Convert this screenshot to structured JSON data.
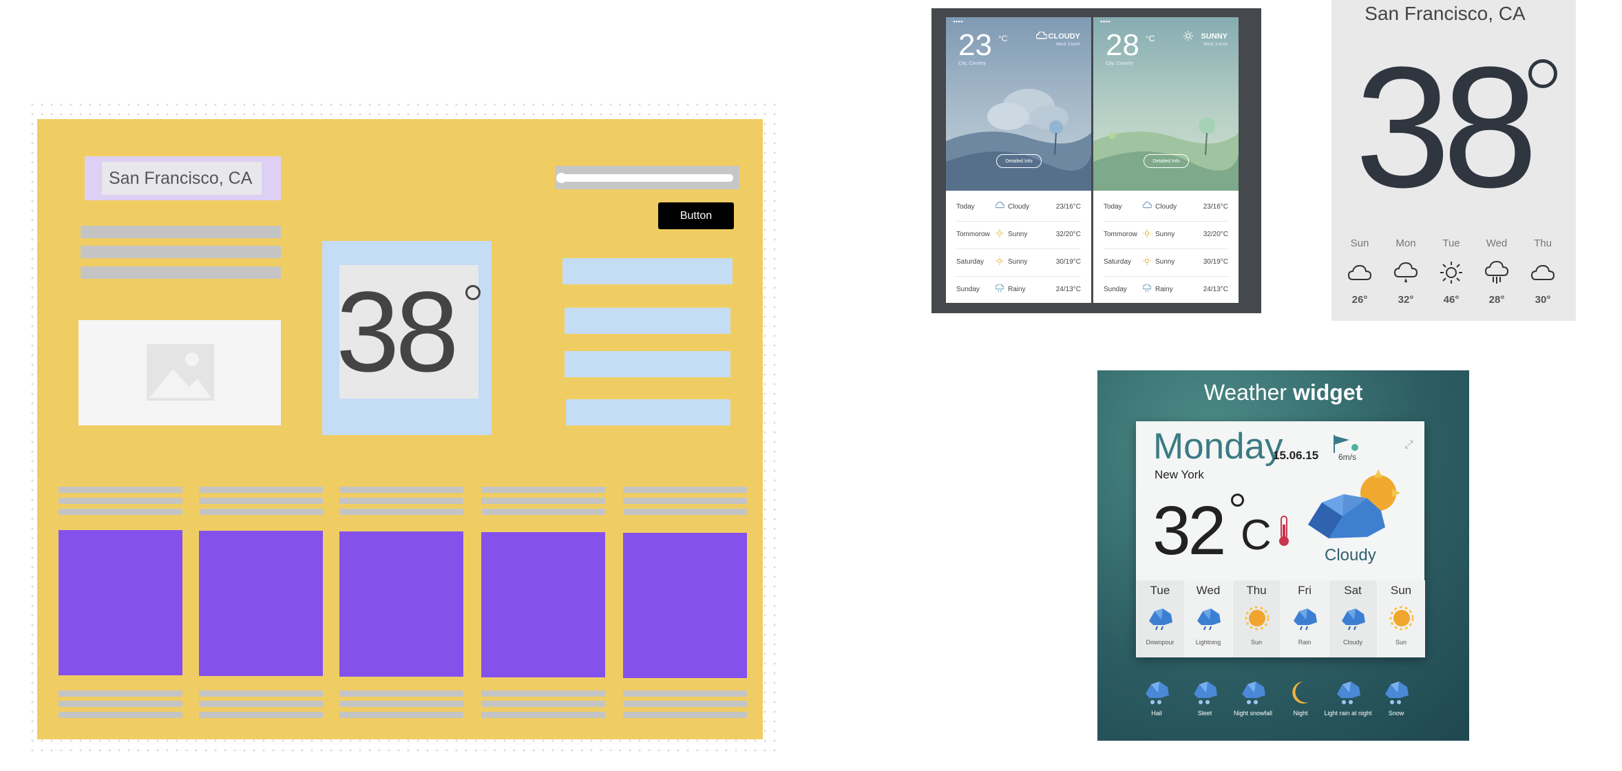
{
  "wireframe": {
    "location_label": "San Francisco, CA",
    "button_label": "Button",
    "temperature": "38",
    "columns": 5
  },
  "phone": {
    "screens": [
      {
        "temp": "23",
        "unit": "°C",
        "condition": "CLOUDY",
        "wind": "Wind: 3 km/h",
        "city": "City, Country",
        "detail_button": "Detailed Info",
        "forecast": [
          {
            "day": "Today",
            "cond": "Cloudy",
            "temp": "23/16°C"
          },
          {
            "day": "Tommorow",
            "cond": "Sunny",
            "temp": "32/20°C"
          },
          {
            "day": "Saturday",
            "cond": "Sunny",
            "temp": "30/19°C"
          },
          {
            "day": "Sunday",
            "cond": "Rainy",
            "temp": "24/13°C"
          }
        ]
      },
      {
        "temp": "28",
        "unit": "°C",
        "condition": "SUNNY",
        "wind": "Wind: 3 km/h",
        "city": "City, Country",
        "detail_button": "Detailed Info",
        "forecast": [
          {
            "day": "Today",
            "cond": "Cloudy",
            "temp": "23/16°C"
          },
          {
            "day": "Tommorow",
            "cond": "Sunny",
            "temp": "32/20°C"
          },
          {
            "day": "Saturday",
            "cond": "Sunny",
            "temp": "30/19°C"
          },
          {
            "day": "Sunday",
            "cond": "Rainy",
            "temp": "24/13°C"
          }
        ]
      }
    ]
  },
  "sf_card": {
    "city": "San Francisco, CA",
    "temp": "38",
    "days": [
      {
        "day": "Sun",
        "icon": "cloud-icon",
        "temp": "26°"
      },
      {
        "day": "Mon",
        "icon": "drizzle-icon",
        "temp": "32°"
      },
      {
        "day": "Tue",
        "icon": "sun-icon",
        "temp": "46°"
      },
      {
        "day": "Wed",
        "icon": "rain-icon",
        "temp": "28°"
      },
      {
        "day": "Thu",
        "icon": "cloud-icon",
        "temp": "30°"
      }
    ]
  },
  "widget": {
    "title_light": "Weather ",
    "title_bold": "widget",
    "weekday": "Monday",
    "date": "15.06.15",
    "city": "New York",
    "temp": "32",
    "unit": "C",
    "condition": "Cloudy",
    "wind_speed": "6m/s",
    "forecast": [
      {
        "day": "Tue",
        "label": "Downpour"
      },
      {
        "day": "Wed",
        "label": "Lightning"
      },
      {
        "day": "Thu",
        "label": "Sun"
      },
      {
        "day": "Fri",
        "label": "Rain"
      },
      {
        "day": "Sat",
        "label": "Cloudy"
      },
      {
        "day": "Sun",
        "label": "Sun"
      }
    ],
    "icons_row": [
      "Hail",
      "Sleet",
      "Night snowfall",
      "Night",
      "Light rain at night",
      "Snow"
    ]
  }
}
